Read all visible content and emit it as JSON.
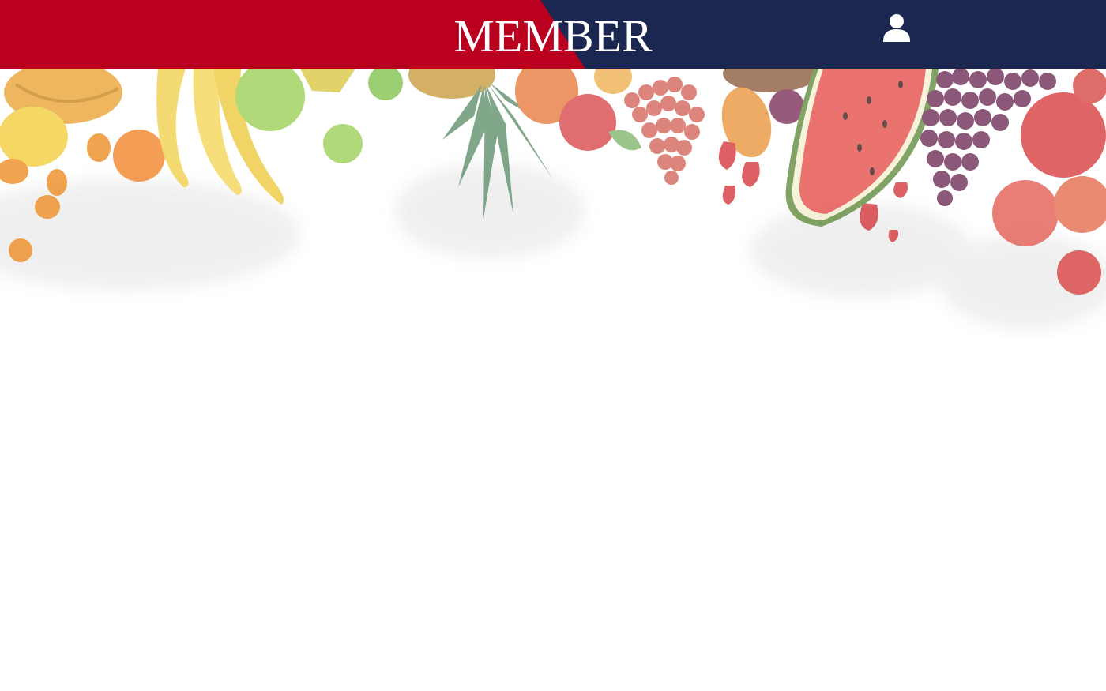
{
  "header": {
    "title": "MEMBER",
    "colors": {
      "left": "#BB001F",
      "right": "#1B2750",
      "title": "#FFFFFF"
    },
    "user_icon": "user-icon"
  },
  "banner": {
    "description_icon": "fruit-banner-image"
  }
}
